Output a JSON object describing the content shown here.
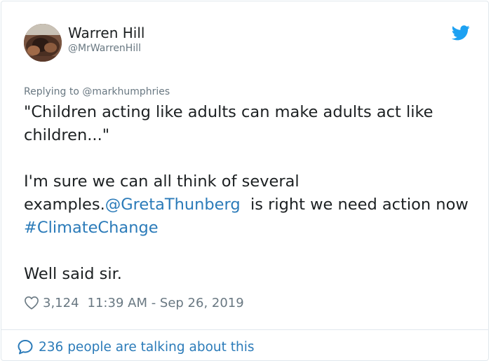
{
  "author": {
    "name": "Warren Hill",
    "handle": "@MrWarrenHill"
  },
  "tweet": {
    "replying_prefix": "Replying to ",
    "replying_to": "@markhumphries",
    "line1": "\"Children acting like adults can make adults act like children...\"",
    "line2_start": "I'm sure we can all think of several examples.",
    "mention": "@GretaThunberg",
    "line2_middle": "  is right we need action now ",
    "hashtag": "#ClimateChange",
    "line3": "Well said sir."
  },
  "meta": {
    "likes": "3,124",
    "timestamp": "11:39 AM - Sep 26, 2019"
  },
  "footer": {
    "talking": "236 people are talking about this"
  },
  "icons": {
    "bird": "twitter-bird-icon",
    "heart": "heart-outline-icon",
    "bubble": "speech-bubble-icon"
  },
  "colors": {
    "accent": "#2b7bb9",
    "twitter_blue": "#1da1f2",
    "muted": "#697882",
    "text": "#1c2022",
    "border": "#e1e8ed"
  }
}
